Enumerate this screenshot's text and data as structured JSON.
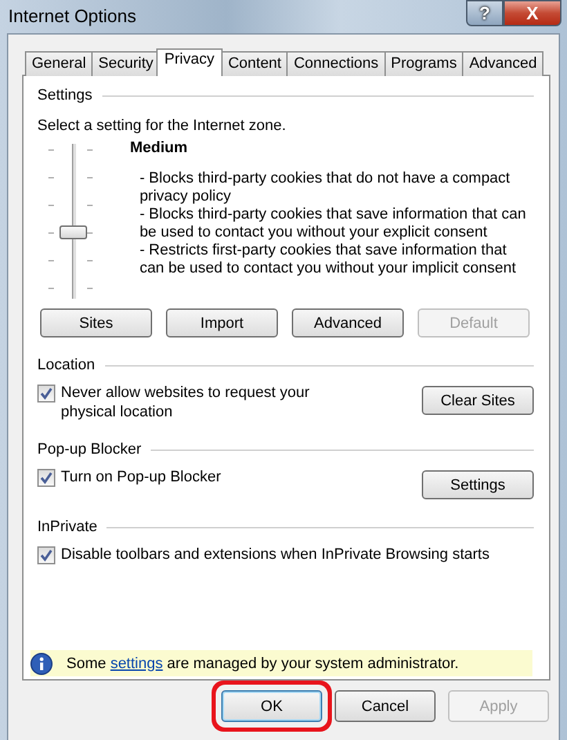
{
  "window": {
    "title": "Internet Options",
    "help_button": "?",
    "close_button": "X"
  },
  "tabs": [
    {
      "label": "General",
      "selected": false
    },
    {
      "label": "Security",
      "selected": false
    },
    {
      "label": "Privacy",
      "selected": true
    },
    {
      "label": "Content",
      "selected": false
    },
    {
      "label": "Connections",
      "selected": false
    },
    {
      "label": "Programs",
      "selected": false
    },
    {
      "label": "Advanced",
      "selected": false
    }
  ],
  "settings": {
    "heading": "Settings",
    "prompt": "Select a setting for the Internet zone.",
    "slider": {
      "level": 0.4
    },
    "level_name": "Medium",
    "description": [
      "- Blocks third-party cookies that do not have a compact privacy policy",
      "- Blocks third-party cookies that save information that can be used to contact you without your explicit consent",
      "- Restricts first-party cookies that save information that can be used to contact you without your implicit consent"
    ],
    "buttons": [
      {
        "label": "Sites",
        "disabled": false
      },
      {
        "label": "Import",
        "disabled": false
      },
      {
        "label": "Advanced",
        "disabled": false
      },
      {
        "label": "Default",
        "disabled": true
      }
    ]
  },
  "sections": [
    {
      "heading": "Location",
      "checkbox": {
        "label": "Never allow websites to request your physical location",
        "checked": true
      },
      "button": "Clear Sites"
    },
    {
      "heading": "Pop-up Blocker",
      "checkbox": {
        "label": "Turn on Pop-up Blocker",
        "checked": true
      },
      "button": "Settings"
    },
    {
      "heading": "InPrivate",
      "checkbox": {
        "label": "Disable toolbars and extensions when InPrivate Browsing starts",
        "checked": true
      }
    }
  ],
  "info_bar": {
    "before": "Some",
    "link": "settings",
    "after": "are managed by your system administrator."
  },
  "dialog_buttons": [
    {
      "label": "OK",
      "disabled": false,
      "highlighted": true
    },
    {
      "label": "Cancel",
      "disabled": false,
      "highlighted": false
    },
    {
      "label": "Apply",
      "disabled": true,
      "highlighted": false
    }
  ]
}
